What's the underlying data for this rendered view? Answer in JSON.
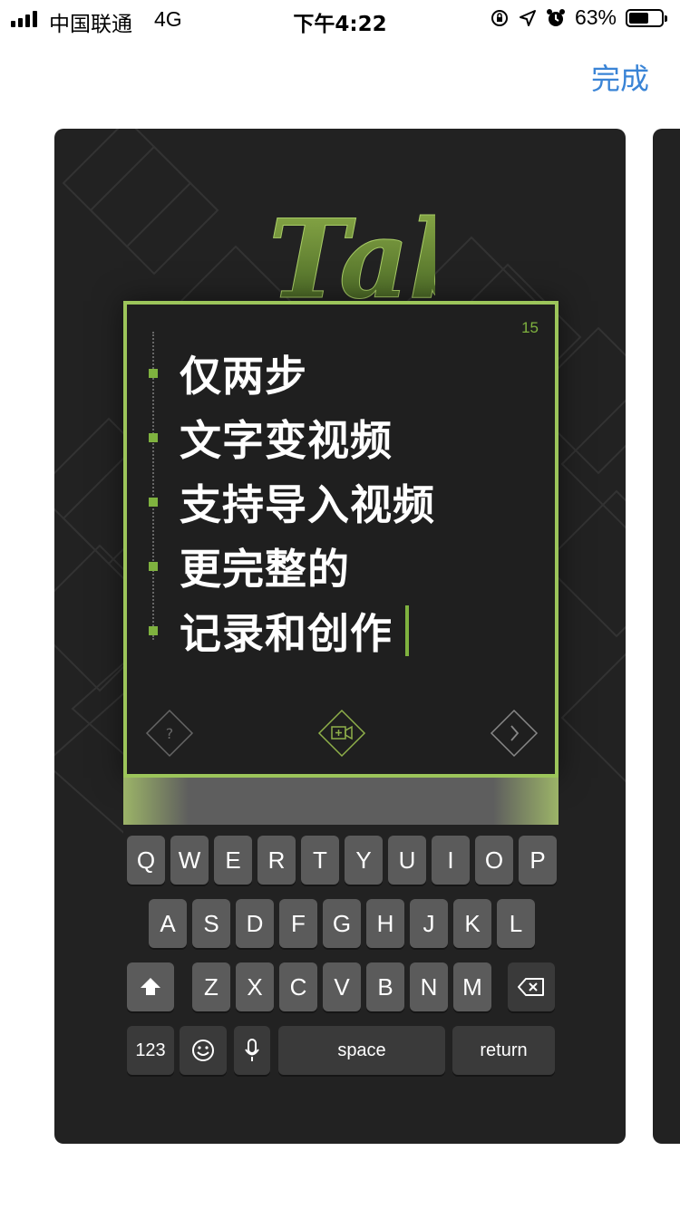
{
  "status_bar": {
    "carrier": "中国联通",
    "network": "4G",
    "time": "下午4:22",
    "battery_pct": "63%",
    "battery_level": 0.63,
    "icons": [
      "rotation-lock-icon",
      "location-arrow-icon",
      "alarm-icon"
    ]
  },
  "header": {
    "done_label": "完成"
  },
  "card": {
    "logo_text": "Tab",
    "counter": "15",
    "lines": [
      "仅两步",
      "文字变视频",
      "支持导入视频",
      "更完整的",
      "记录和创作"
    ],
    "controls": [
      "help-icon",
      "video-add-icon",
      "next-chevron-icon"
    ]
  },
  "keyboard": {
    "row1": [
      "Q",
      "W",
      "E",
      "R",
      "T",
      "Y",
      "U",
      "I",
      "O",
      "P"
    ],
    "row2": [
      "A",
      "S",
      "D",
      "F",
      "G",
      "H",
      "J",
      "K",
      "L"
    ],
    "row3": [
      "Z",
      "X",
      "C",
      "V",
      "B",
      "N",
      "M"
    ],
    "num_label": "123",
    "space_label": "space",
    "return_label": "return"
  },
  "colors": {
    "accent_green": "#9cc55a",
    "done_blue": "#3a84d6",
    "card_bg": "#222222"
  }
}
